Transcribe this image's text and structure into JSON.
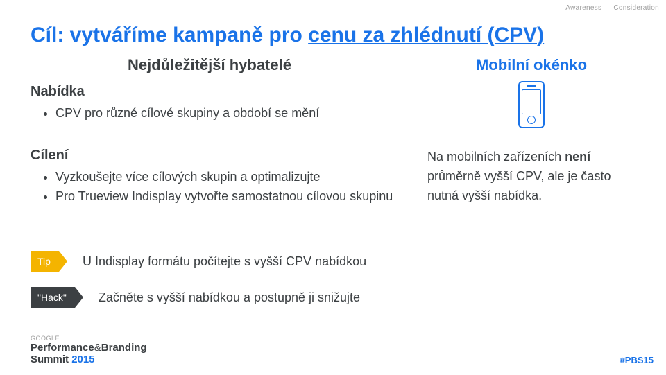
{
  "topright": {
    "awareness": "Awareness",
    "consideration": "Consideration"
  },
  "title_prefix": "Cíl: vytváříme kampaně pro ",
  "title_under": "cenu za zhlédnutí (CPV)",
  "subtitle": "Nejdůležitější hybatelé",
  "mobile_window": "Mobilní okénko",
  "nabidka": {
    "label": "Nabídka",
    "items": [
      "CPV pro různé cílové skupiny a období se mění"
    ]
  },
  "cileni": {
    "label": "Cílení",
    "items": [
      "Vyzkoušejte více cílových skupin a optimalizujte",
      "Pro Trueview Indisplay vytvořte samostatnou cílovou skupinu"
    ]
  },
  "mobile_note": {
    "part1": "Na mobilních zařízeních ",
    "bold": "není",
    "part2": " průměrně vyšší CPV, ale je často nutná vyšší nabídka."
  },
  "tip": {
    "label": "Tip",
    "text": "U Indisplay formátu počítejte s vyšší CPV nabídkou"
  },
  "hack": {
    "label": "\"Hack\"",
    "text": "Začněte s vyšší nabídkou a postupně ji snižujte"
  },
  "footer": {
    "google": "GOOGLE",
    "line1a": "Performance",
    "line1amp": "&",
    "line1b": "Branding",
    "line2a": "Summit ",
    "line2b": "2015"
  },
  "hashtag": "#PBS15"
}
